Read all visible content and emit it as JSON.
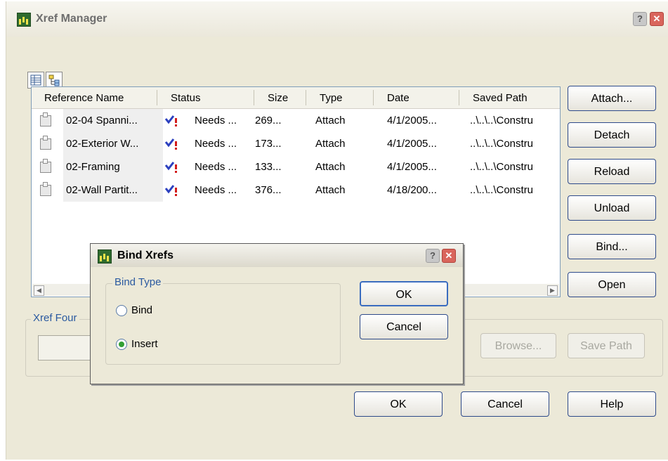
{
  "window": {
    "title": "Xref Manager",
    "help_glyph": "?",
    "close_glyph": "✕"
  },
  "view_buttons": {
    "list_view_icon": "list-view-icon",
    "tree_view_icon": "tree-view-icon"
  },
  "table": {
    "headers": [
      "Reference Name",
      "Status",
      "Size",
      "Type",
      "Date",
      "Saved Path"
    ],
    "rows": [
      {
        "name": "02-04 Spanni...",
        "status": "Needs ...",
        "size": "269...",
        "type": "Attach",
        "date": "4/1/2005...",
        "path": "..\\..\\..\\Constru"
      },
      {
        "name": "02-Exterior W...",
        "status": "Needs ...",
        "size": "173...",
        "type": "Attach",
        "date": "4/1/2005...",
        "path": "..\\..\\..\\Constru"
      },
      {
        "name": "02-Framing",
        "status": "Needs ...",
        "size": "133...",
        "type": "Attach",
        "date": "4/1/2005...",
        "path": "..\\..\\..\\Constru"
      },
      {
        "name": "02-Wall Partit...",
        "status": "Needs ...",
        "size": "376...",
        "type": "Attach",
        "date": "4/18/200...",
        "path": "..\\..\\..\\Constru"
      }
    ],
    "status_icon": "needs-reload-icon"
  },
  "side_buttons": {
    "attach": "Attach...",
    "detach": "Detach",
    "reload": "Reload",
    "unload": "Unload",
    "bind": "Bind...",
    "open": "Open"
  },
  "xref_found": {
    "label": "Xref Four",
    "path_value": "",
    "browse": "Browse...",
    "save_path": "Save Path"
  },
  "footer": {
    "ok": "OK",
    "cancel": "Cancel",
    "help": "Help"
  },
  "bind_dialog": {
    "title": "Bind Xrefs",
    "group_label": "Bind Type",
    "options": [
      {
        "label": "Bind",
        "selected": false
      },
      {
        "label": "Insert",
        "selected": true
      }
    ],
    "ok": "OK",
    "cancel": "Cancel"
  }
}
